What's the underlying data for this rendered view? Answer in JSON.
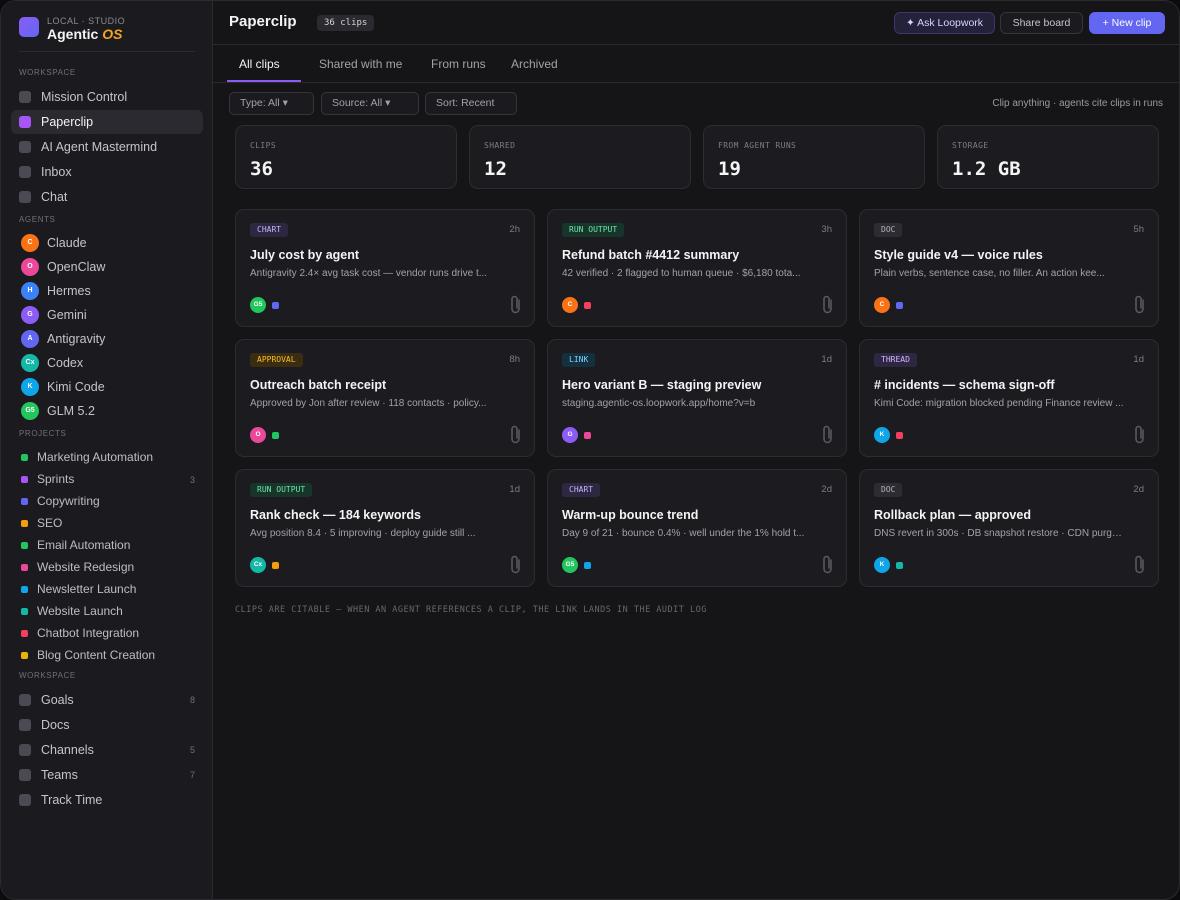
{
  "brand": {
    "subtitle": "LOCAL · STUDIO",
    "title_main": "Agentic ",
    "title_accent": "OS"
  },
  "sidebar": {
    "workspace_label": "WORKSPACE",
    "workspace_items": [
      {
        "label": "Mission Control"
      },
      {
        "label": "Paperclip"
      },
      {
        "label": "AI Agent Mastermind"
      },
      {
        "label": "Inbox"
      },
      {
        "label": "Chat"
      }
    ],
    "agents_label": "AGENTS",
    "agents": [
      {
        "initials": "C",
        "label": "Claude",
        "color": "#f97316"
      },
      {
        "initials": "O",
        "label": "OpenClaw",
        "color": "#ec4899"
      },
      {
        "initials": "H",
        "label": "Hermes",
        "color": "#3b82f6"
      },
      {
        "initials": "G",
        "label": "Gemini",
        "color": "#8b5cf6"
      },
      {
        "initials": "A",
        "label": "Antigravity",
        "color": "#6366f1"
      },
      {
        "initials": "Cx",
        "label": "Codex",
        "color": "#14b8a6"
      },
      {
        "initials": "K",
        "label": "Kimi Code",
        "color": "#0ea5e9"
      },
      {
        "initials": "G5",
        "label": "GLM 5.2",
        "color": "#22c55e"
      }
    ],
    "projects_label": "PROJECTS",
    "projects": [
      {
        "label": "Marketing Automation",
        "color": "#22c55e",
        "count": ""
      },
      {
        "label": "Sprints",
        "color": "#a855f7",
        "count": "3"
      },
      {
        "label": "Copywriting",
        "color": "#6366f1",
        "count": ""
      },
      {
        "label": "SEO",
        "color": "#f59e0b",
        "count": ""
      },
      {
        "label": "Email Automation",
        "color": "#22c55e",
        "count": ""
      },
      {
        "label": "Website Redesign",
        "color": "#ec4899",
        "count": ""
      },
      {
        "label": "Newsletter Launch",
        "color": "#0ea5e9",
        "count": ""
      },
      {
        "label": "Website Launch",
        "color": "#14b8a6",
        "count": ""
      },
      {
        "label": "Chatbot Integration",
        "color": "#f43f5e",
        "count": ""
      },
      {
        "label": "Blog Content Creation",
        "color": "#eab308",
        "count": ""
      }
    ],
    "workspace2_label": "WORKSPACE",
    "workspace2_items": [
      {
        "label": "Goals",
        "count": "8"
      },
      {
        "label": "Docs",
        "count": ""
      },
      {
        "label": "Channels",
        "count": "5"
      },
      {
        "label": "Teams",
        "count": "7"
      },
      {
        "label": "Track Time",
        "count": ""
      }
    ]
  },
  "header": {
    "title": "Paperclip",
    "count_badge": "36 clips",
    "ask_button": "✦ Ask Loopwork",
    "share_button": "Share board",
    "new_button": "+ New clip"
  },
  "tabs": [
    "All clips",
    "Shared with me",
    "From runs",
    "Archived"
  ],
  "filters": {
    "type": "Type: All ▾",
    "source": "Source: All ▾",
    "sort": "Sort: Recent",
    "hint": "Clip anything · agents cite clips in runs"
  },
  "stats": [
    {
      "label": "CLIPS",
      "value": "36"
    },
    {
      "label": "SHARED",
      "value": "12"
    },
    {
      "label": "FROM AGENT RUNS",
      "value": "19"
    },
    {
      "label": "STORAGE",
      "value": "1.2 GB"
    }
  ],
  "clips": [
    {
      "tag": "CHART",
      "tag_class": "chart",
      "age": "2h",
      "title": "July cost by agent",
      "desc": "Antigravity 2.4× avg task cost — vendor runs drive t...",
      "avatar": "G5",
      "avatar_color": "#22c55e",
      "dot_color": "#6366f1"
    },
    {
      "tag": "RUN OUTPUT",
      "tag_class": "run",
      "age": "3h",
      "title": "Refund batch #4412 summary",
      "desc": "42 verified · 2 flagged to human queue · $6,180 tota...",
      "avatar": "C",
      "avatar_color": "#f97316",
      "dot_color": "#f43f5e"
    },
    {
      "tag": "DOC",
      "tag_class": "doc",
      "age": "5h",
      "title": "Style guide v4 — voice rules",
      "desc": "Plain verbs, sentence case, no filler. An action kee...",
      "avatar": "C",
      "avatar_color": "#f97316",
      "dot_color": "#6366f1"
    },
    {
      "tag": "APPROVAL",
      "tag_class": "approval",
      "age": "8h",
      "title": "Outreach batch receipt",
      "desc": "Approved by Jon after review · 118 contacts · policy...",
      "avatar": "O",
      "avatar_color": "#ec4899",
      "dot_color": "#22c55e"
    },
    {
      "tag": "LINK",
      "tag_class": "link",
      "age": "1d",
      "title": "Hero variant B — staging preview",
      "desc": "staging.agentic-os.loopwork.app/home?v=b",
      "avatar": "G",
      "avatar_color": "#8b5cf6",
      "dot_color": "#ec4899"
    },
    {
      "tag": "THREAD",
      "tag_class": "thread",
      "age": "1d",
      "title": "# incidents — schema sign-off",
      "desc": "Kimi Code: migration blocked pending Finance review ...",
      "avatar": "K",
      "avatar_color": "#0ea5e9",
      "dot_color": "#f43f5e"
    },
    {
      "tag": "RUN OUTPUT",
      "tag_class": "run",
      "age": "1d",
      "title": "Rank check — 184 keywords",
      "desc": "Avg position 8.4 · 5 improving · deploy guide still ...",
      "avatar": "Cx",
      "avatar_color": "#14b8a6",
      "dot_color": "#f59e0b"
    },
    {
      "tag": "CHART",
      "tag_class": "chart",
      "age": "2d",
      "title": "Warm-up bounce trend",
      "desc": "Day 9 of 21 · bounce 0.4% · well under the 1% hold t...",
      "avatar": "G5",
      "avatar_color": "#22c55e",
      "dot_color": "#0ea5e9"
    },
    {
      "tag": "DOC",
      "tag_class": "doc",
      "age": "2d",
      "title": "Rollback plan — approved",
      "desc": "DNS revert in 300s · DB snapshot restore · CDN purge...",
      "avatar": "K",
      "avatar_color": "#0ea5e9",
      "dot_color": "#14b8a6"
    }
  ],
  "footnote": "CLIPS ARE CITABLE — WHEN AN AGENT REFERENCES A CLIP, THE LINK LANDS IN THE AUDIT LOG"
}
